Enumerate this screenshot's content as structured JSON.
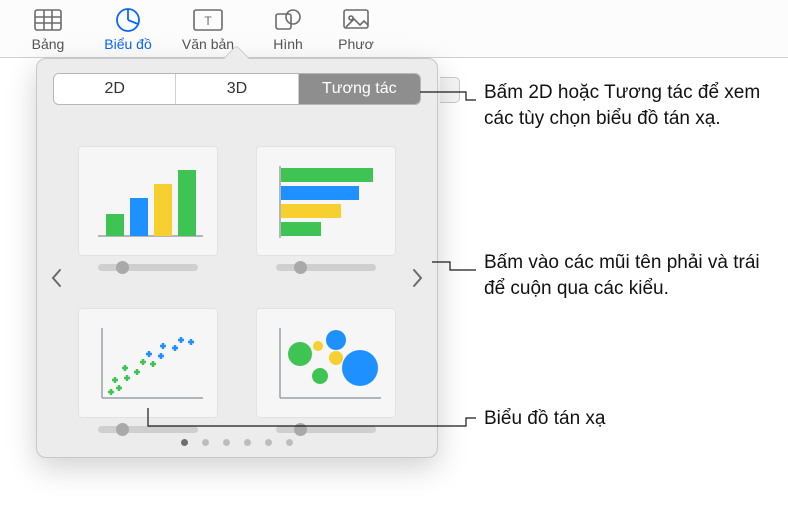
{
  "toolbar": {
    "table": "Bảng",
    "chart": "Biểu đồ",
    "text": "Văn bản",
    "shape": "Hình",
    "media": "Phươ"
  },
  "popover": {
    "tabs": {
      "two_d": "2D",
      "three_d": "3D",
      "interactive": "Tương tác"
    },
    "thumbs": {
      "column": "column-chart",
      "bar": "bar-chart",
      "scatter": "scatter-chart",
      "bubble": "bubble-chart"
    }
  },
  "callouts": {
    "tabs": "Bấm 2D hoặc Tương tác để xem các tùy chọn biểu đồ tán xạ.",
    "arrows": "Bấm vào các mũi tên phải và trái để cuộn qua các kiểu.",
    "scatter": "Biểu đồ tán xạ"
  },
  "colors": {
    "green": "#3fc454",
    "blue": "#1e90ff",
    "yellow": "#f7cf2f",
    "gray": "#9aa0a6"
  }
}
